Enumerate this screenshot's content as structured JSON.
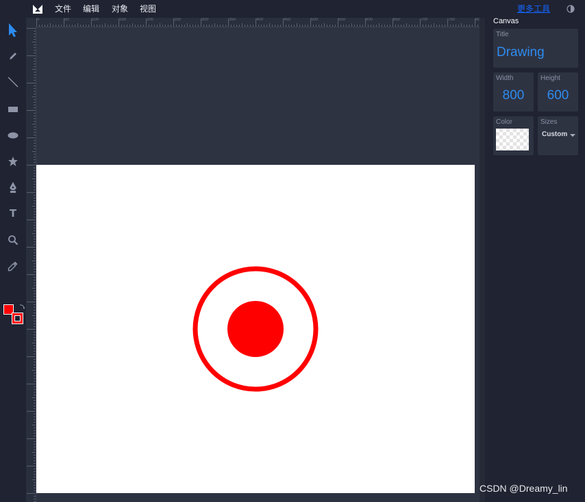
{
  "menu": {
    "items": [
      "文件",
      "编辑",
      "对象",
      "视图"
    ],
    "link": "更多工具"
  },
  "toolbar": {
    "tools": [
      {
        "id": "select",
        "icon": "cursor-arrow-icon",
        "active": true
      },
      {
        "id": "pencil",
        "icon": "pencil-icon"
      },
      {
        "id": "line",
        "icon": "line-icon"
      },
      {
        "id": "rect",
        "icon": "rectangle-icon"
      },
      {
        "id": "ellipse",
        "icon": "ellipse-icon"
      },
      {
        "id": "star",
        "icon": "star-icon"
      },
      {
        "id": "pen",
        "icon": "pen-nib-icon"
      },
      {
        "id": "text",
        "icon": "text-icon",
        "label": "T"
      },
      {
        "id": "zoom",
        "icon": "magnifier-icon"
      },
      {
        "id": "eyedropper",
        "icon": "eyedropper-icon"
      }
    ],
    "fill_color": "#ff0000",
    "stroke_color": "#ff0000"
  },
  "rulers": {
    "top_labels": [
      "0",
      "50",
      "100",
      "150",
      "200",
      "250",
      "300",
      "350",
      "400",
      "450",
      "500",
      "550",
      "600",
      "650",
      "700",
      "750",
      "800"
    ]
  },
  "panel": {
    "title": "Canvas",
    "title_card": {
      "label": "Title",
      "value": "Drawing"
    },
    "width_card": {
      "label": "Width",
      "value": "800"
    },
    "height_card": {
      "label": "Height",
      "value": "600"
    },
    "color_card": {
      "label": "Color"
    },
    "sizes_card": {
      "label": "Sizes",
      "value": "Custom"
    }
  },
  "canvas": {
    "background": "#ffffff",
    "shape_color": "#ff0000"
  },
  "watermark": "CSDN @Dreamy_lin",
  "colors": {
    "accent": "#2d8cf0",
    "app_bg": "#1f2332",
    "workspace_bg": "#2e3342"
  }
}
